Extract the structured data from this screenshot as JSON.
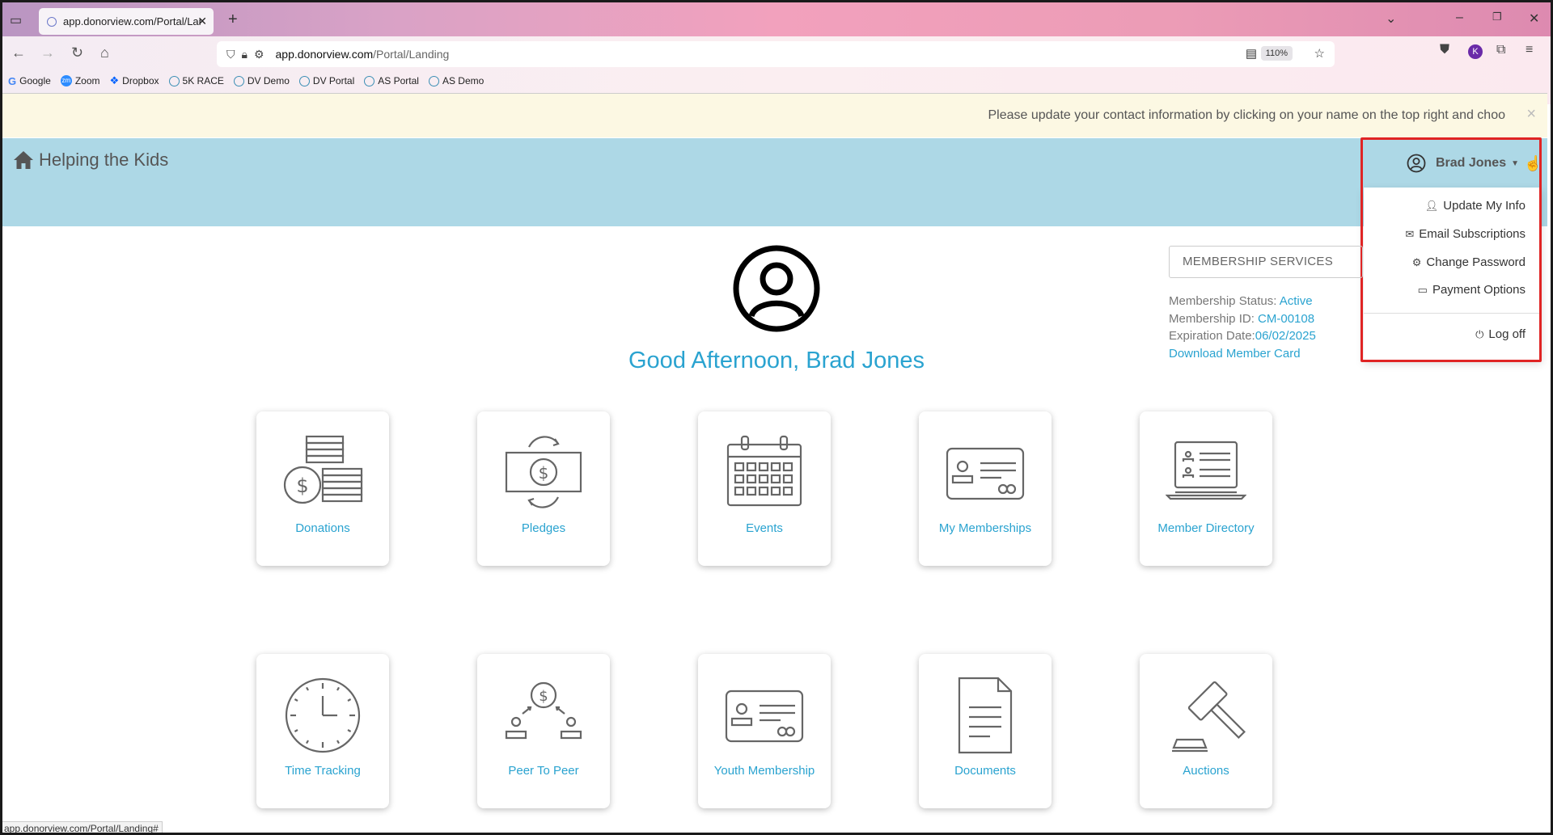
{
  "browser": {
    "tab_title": "app.donorview.com/Portal/Landi",
    "url_domain": "app.donorview.com",
    "url_path": "/Portal/Landing",
    "zoom": "110%",
    "profile_initial": "K",
    "bookmarks": [
      "Google",
      "Zoom",
      "Dropbox",
      "5K RACE",
      "DV Demo",
      "DV Portal",
      "AS Portal",
      "AS Demo"
    ],
    "status_url": "app.donorview.com/Portal/Landing#"
  },
  "notice": {
    "message": "Please update your contact information by clicking on your name on the top right and choo",
    "close": "×"
  },
  "header": {
    "org_name": "Helping the Kids"
  },
  "user": {
    "name": "Brad Jones",
    "greeting": "Good Afternoon, Brad Jones"
  },
  "dropdown": {
    "items": [
      "Update My Info",
      "Email Subscriptions",
      "Change Password",
      "Payment Options"
    ],
    "logoff": "Log off"
  },
  "membership": {
    "services_label": "MEMBERSHIP SERVICES",
    "status_label": "Membership Status:",
    "status_value": "Active",
    "id_label": "Membership ID:",
    "id_value": "CM-00108",
    "exp_label": "Expiration Date:",
    "exp_value": "06/02/2025",
    "download": "Download Member Card"
  },
  "tiles": [
    "Donations",
    "Pledges",
    "Events",
    "My Memberships",
    "Member Directory",
    "Time Tracking",
    "Peer To Peer",
    "Youth Membership",
    "Documents",
    "Auctions"
  ],
  "colors": {
    "accent": "#2aa3d0",
    "header_bg": "#add8e6",
    "notice_bg": "#fcf8e3",
    "highlight": "#e02424"
  }
}
